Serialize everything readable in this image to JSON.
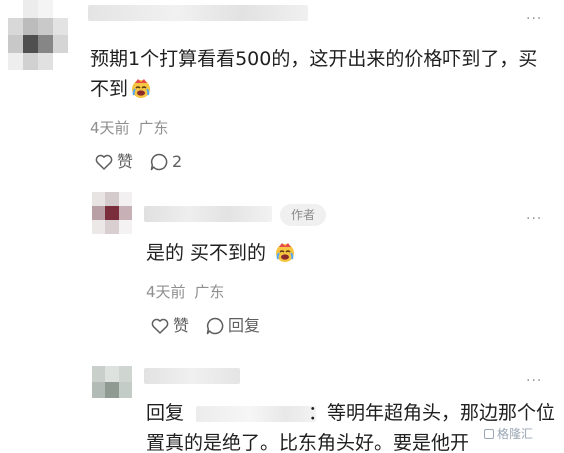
{
  "comments": [
    {
      "text": "预期1个打算看看500的，这开出来的价格吓到了，买不到",
      "emoji_icon": "crying-laughing-face-icon",
      "time": "4天前",
      "location": "广东",
      "like_label": "赞",
      "comment_count": "2"
    },
    {
      "text": "是的 买不到的",
      "emoji_icon": "crying-laughing-face-icon",
      "author_badge": "作者",
      "time": "4天前",
      "location": "广东",
      "like_label": "赞",
      "reply_label": "回复"
    },
    {
      "text_prefix": "回复",
      "text_suffix": "：等明年超角头，那边那个位置真的是绝了。比东角头好。要是他开"
    }
  ],
  "more_icon": "more-dots-icon",
  "watermark": "格隆汇",
  "colors": {
    "meta": "#8f8f8f",
    "text": "#1f1f1f",
    "action": "#5e5e5e",
    "badge_bg": "#f0f0f0"
  }
}
